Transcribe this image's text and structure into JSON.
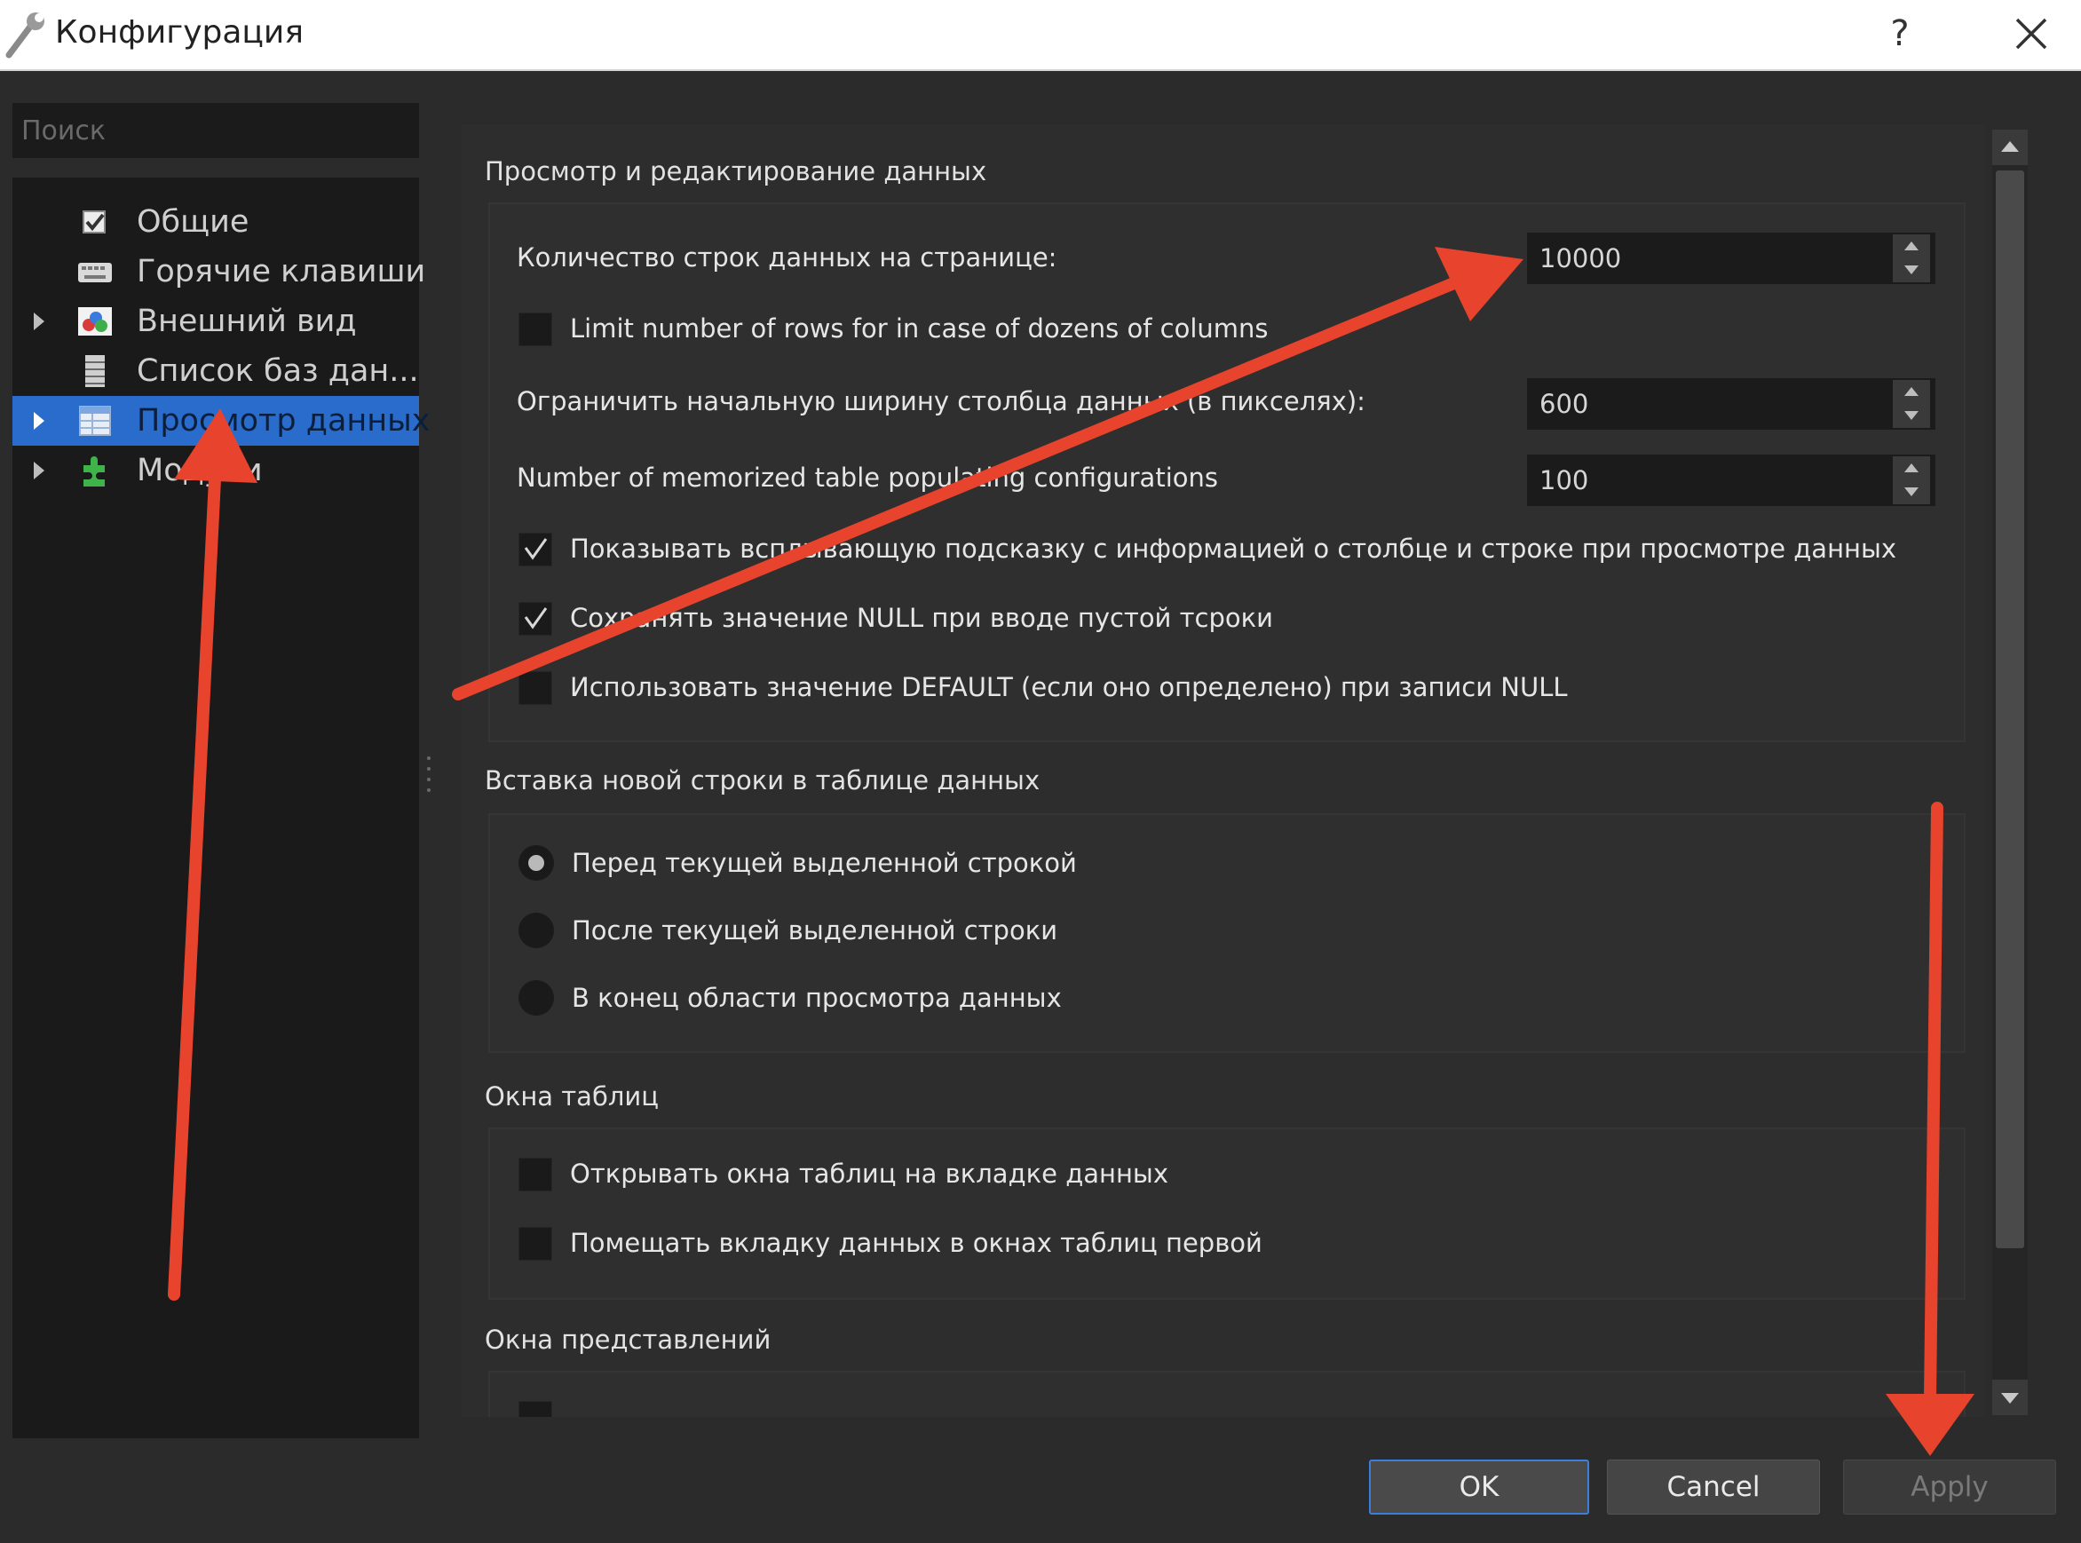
{
  "window": {
    "title": "Конфигурация",
    "help_label": "?"
  },
  "sidebar": {
    "search_placeholder": "Поиск",
    "items": [
      {
        "label": "Общие",
        "icon": "checkbox-icon",
        "expandable": false,
        "selected": false
      },
      {
        "label": "Горячие клавиши",
        "icon": "keyboard-icon",
        "expandable": false,
        "selected": false
      },
      {
        "label": "Внешний вид",
        "icon": "appearance-icon",
        "expandable": true,
        "selected": false
      },
      {
        "label": "Список баз дан...",
        "icon": "database-list-icon",
        "expandable": false,
        "selected": false
      },
      {
        "label": "Просмотр данных",
        "icon": "data-view-icon",
        "expandable": true,
        "selected": true
      },
      {
        "label": "Модули",
        "icon": "plugin-icon",
        "expandable": true,
        "selected": false
      }
    ]
  },
  "data_view": {
    "title": "Просмотр и редактирование данных",
    "rows_per_page_label": "Количество строк данных на странице:",
    "rows_per_page_value": "10000",
    "limit_rows_label": "Limit number of rows for in case of dozens of columns",
    "limit_rows_checked": false,
    "column_width_label": "Ограничить начальную ширину столбца данных (в пикселях):",
    "column_width_value": "600",
    "memorized_configs_label": "Number of memorized table populating configurations",
    "memorized_configs_value": "100",
    "tooltip_label": "Показывать всплывающую подсказку с информацией о столбце и строке при просмотре данных",
    "tooltip_checked": true,
    "keep_null_label": "Сохранять значение NULL при вводе пустой тсроки",
    "keep_null_checked": true,
    "use_default_label": "Использовать значение DEFAULT (если оно определено) при записи NULL",
    "use_default_checked": false
  },
  "insert_row": {
    "title": "Вставка новой строки в таблице данных",
    "options": [
      {
        "label": "Перед текущей выделенной строкой",
        "checked": true
      },
      {
        "label": "После текущей выделенной строки",
        "checked": false
      },
      {
        "label": "В конец области просмотра данных",
        "checked": false
      }
    ]
  },
  "table_windows": {
    "title": "Окна таблиц",
    "open_on_data_tab_label": "Открывать окна таблиц на вкладке данных",
    "open_on_data_tab_checked": false,
    "data_tab_first_label": "Помещать вкладку данных в окнах таблиц первой",
    "data_tab_first_checked": false
  },
  "view_windows": {
    "title": "Окна представлений"
  },
  "buttons": {
    "ok": "OK",
    "cancel": "Cancel",
    "apply": "Apply"
  },
  "colors": {
    "selection": "#2a6ccc",
    "annotation_arrow": "#e8432d",
    "ok_border": "#3d7ddb"
  }
}
